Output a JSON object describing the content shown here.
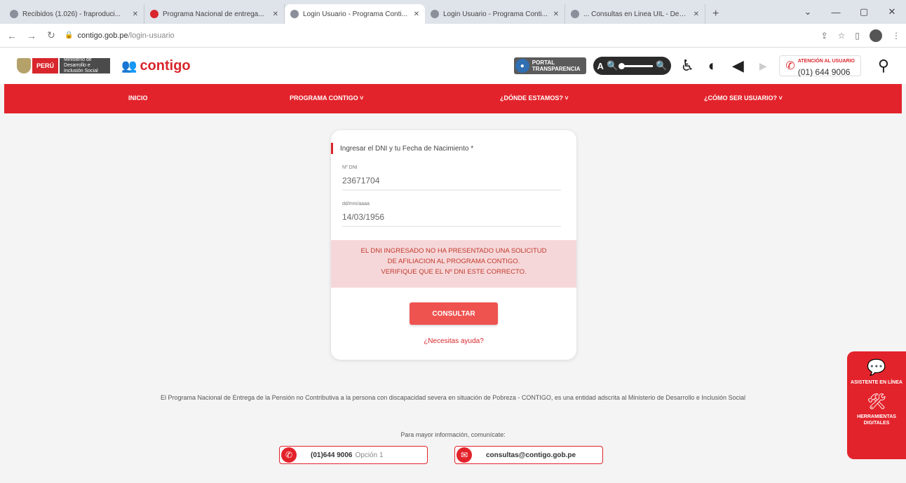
{
  "browser": {
    "tabs": [
      {
        "title": "Recibidos (1.026) - fraproduci...",
        "active": false
      },
      {
        "title": "Programa Nacional de entrega...",
        "active": false
      },
      {
        "title": "Login Usuario - Programa Conti...",
        "active": true
      },
      {
        "title": "Login Usuario - Programa Conti...",
        "active": false
      },
      {
        "title": "... Consultas en Linea UIL - Demo...",
        "active": false
      }
    ],
    "url_host": "contigo.gob.pe",
    "url_path": "/login-usuario"
  },
  "header": {
    "gov_country": "PERÚ",
    "gov_ministry": "Ministerio de Desarrollo e Inclusión Social",
    "brand": "contigo",
    "portal_line1": "PORTAL",
    "portal_line2": "TRANSPARENCIA",
    "zoom_label": "A",
    "atencion_label": "ATENCIÓN AL USUARIO",
    "atencion_phone": "(01) 644 9006"
  },
  "nav": {
    "items": [
      "INICIO",
      "PROGRAMA CONTIGO ˅",
      "¿DÓNDE ESTAMOS? ˅",
      "¿CÓMO SER USUARIO? ˅"
    ]
  },
  "form": {
    "title": "Ingresar el DNI y tu Fecha de Nacimiento *",
    "dni_label": "Nº DNI",
    "dni_value": "23671704",
    "date_label": "dd/mm/aaaa",
    "date_value": "14/03/1956",
    "alert_line1": "EL DNI INGRESADO NO HA PRESENTADO UNA SOLICITUD",
    "alert_line2": "DE AFILIACION AL PROGRAMA CONTIGO.",
    "alert_line3": "VERIFIQUE QUE EL Nº DNI ESTE CORRECTO.",
    "submit_label": "CONSULTAR",
    "help_link": "¿Necesitas ayuda?"
  },
  "footer": {
    "description": "El Programa Nacional de Entrega de la Pensión no Contributiva a la persona con discapacidad severa en situación de Pobreza - CONTIGO, es una entidad adscrita al Ministerio de Desarrollo e Inclusión Social",
    "more_info": "Para mayor información, comunícate:",
    "phone": "(01)644 9006",
    "phone_option": "Opción 1",
    "email": "consultas@contigo.gob.pe"
  },
  "side_widget": {
    "chat_label": "ASISTENTE EN LÍNEA",
    "tools_label": "HERRAMIENTAS DIGITALES"
  },
  "colors": {
    "brand_red": "#e3232b",
    "alert_bg": "#f6d7d9",
    "button": "#ef5350"
  }
}
